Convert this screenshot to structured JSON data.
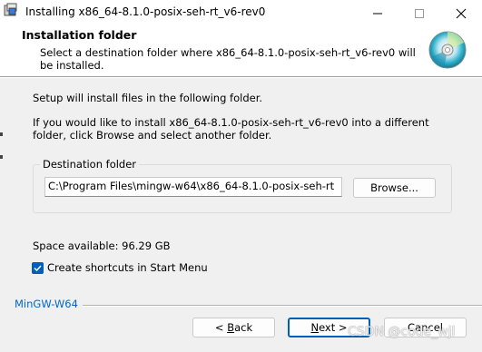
{
  "window": {
    "title": "Installing x86_64-8.1.0-posix-seh-rt_v6-rev0"
  },
  "header": {
    "title": "Installation folder",
    "subtitle": "Select a destination folder where x86_64-8.1.0-posix-seh-rt_v6-rev0 will be installed.",
    "icon": "cd-disc-icon"
  },
  "body": {
    "intro": "Setup will install files in the following folder.",
    "instructions": "If you would like to install x86_64-8.1.0-posix-seh-rt_v6-rev0 into a different folder, click Browse and select another folder."
  },
  "destination": {
    "legend": "Destination folder",
    "path": "C:\\Program Files\\mingw-w64\\x86_64-8.1.0-posix-seh-rt",
    "browse_label": "Browse..."
  },
  "space_available": "Space available: 96.29 GB",
  "shortcuts": {
    "label": "Create shortcuts in Start Menu",
    "checked": true
  },
  "footer": {
    "brand": "MinGW-W64",
    "back_prefix": "< ",
    "back_key": "B",
    "back_rest": "ack",
    "next_prefix": "",
    "next_key": "N",
    "next_rest": "ext >",
    "cancel_label": "Cancel"
  },
  "watermark": "CSDN @code_wjl",
  "colors": {
    "accent": "#005fb8",
    "brand": "#0066cc",
    "panel": "#f0f0f0"
  }
}
